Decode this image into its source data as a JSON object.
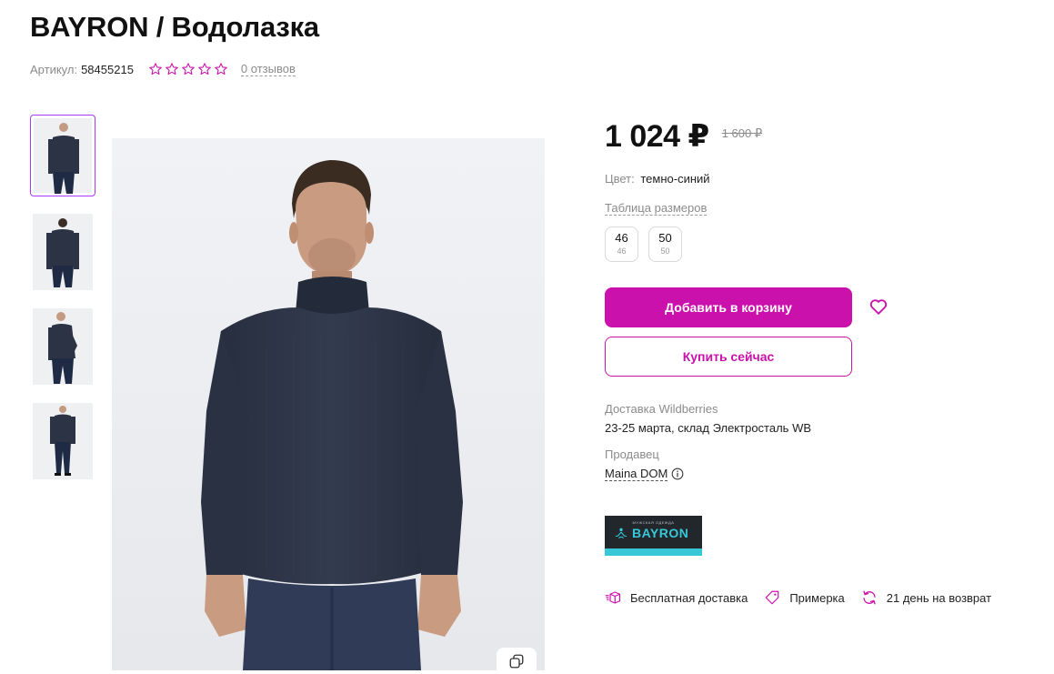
{
  "product": {
    "title": "BAYRON / Водолазка",
    "sku_label": "Артикул:",
    "sku": "58455215",
    "rating_stars": 0,
    "reviews_text": "0 отзывов"
  },
  "pricing": {
    "price": "1 024 ₽",
    "old_price": "1 600 ₽"
  },
  "color": {
    "label": "Цвет:",
    "value": "темно-синий"
  },
  "size_table_link": "Таблица размеров",
  "sizes": [
    {
      "size": "46",
      "ru": "46"
    },
    {
      "size": "50",
      "ru": "50"
    }
  ],
  "actions": {
    "add_to_cart": "Добавить в корзину",
    "buy_now": "Купить сейчас"
  },
  "delivery": {
    "label": "Доставка Wildberries",
    "value": "23-25 марта, склад Электросталь WB"
  },
  "seller": {
    "label": "Продавец",
    "name": "Maina DOM"
  },
  "brand_logo": {
    "subtitle": "МУЖСКАЯ ОДЕЖДА",
    "name": "BAYRON"
  },
  "features": [
    {
      "icon": "box-icon",
      "label": "Бесплатная доставка"
    },
    {
      "icon": "tag-icon",
      "label": "Примерка"
    },
    {
      "icon": "refresh-icon",
      "label": "21 день на возврат"
    }
  ],
  "colors": {
    "accent": "#cb11ab",
    "thumb_border": "#a73afd",
    "sweater": "#2c3344",
    "muted_text": "#8b8b8b"
  }
}
